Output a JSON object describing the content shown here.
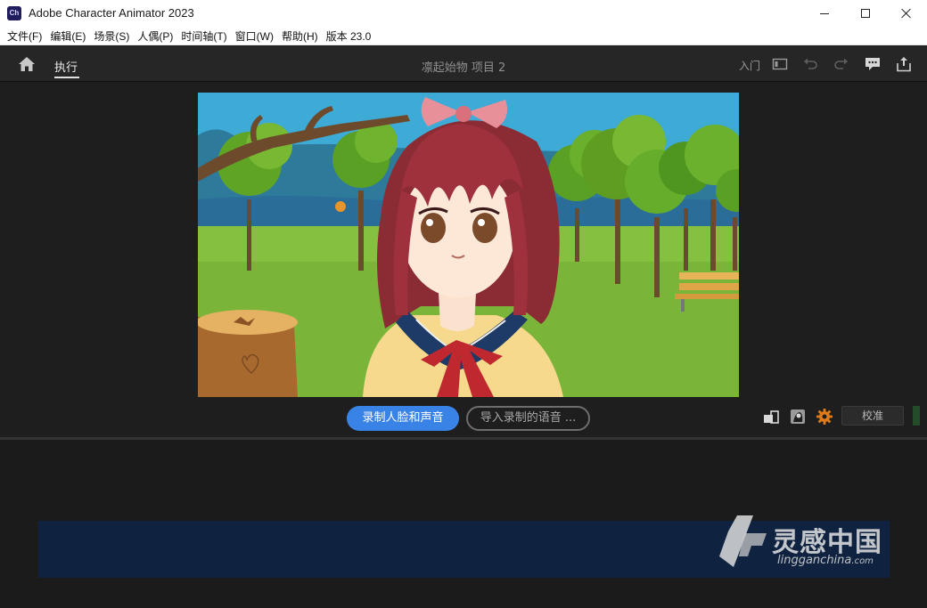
{
  "window": {
    "app_icon_text": "Ch",
    "title": "Adobe Character Animator 2023"
  },
  "menu": {
    "items": [
      {
        "label": "文件(F)"
      },
      {
        "label": "编辑(E)"
      },
      {
        "label": "场景(S)"
      },
      {
        "label": "人偶(P)"
      },
      {
        "label": "时间轴(T)"
      },
      {
        "label": "窗口(W)"
      },
      {
        "label": "帮助(H)"
      },
      {
        "label": "版本 23.0"
      }
    ]
  },
  "header": {
    "home_icon": "home-icon",
    "active_tab": "执行",
    "project_title": "凛起始物 项目 2",
    "start_label": "入门",
    "icons": [
      "panel-icon",
      "undo-icon",
      "redo-icon",
      "comment-icon",
      "share-icon"
    ]
  },
  "controls": {
    "record_label": "录制人脸和声音",
    "import_label": "导入录制的语音 ...",
    "calibrate_label": "校准",
    "tool_icons": [
      "camera-toggle-icon",
      "puppet-track-icon",
      "settings-gear-icon"
    ]
  },
  "watermark": {
    "title": "灵感中国",
    "site": "lingganchina",
    "site_suffix": ".com"
  },
  "colors": {
    "accent": "#3a83e6",
    "header_bg": "#262626",
    "panel_bg": "#1e1e1e",
    "timeline_track": "#0f2240",
    "gear": "#e07b1a"
  }
}
